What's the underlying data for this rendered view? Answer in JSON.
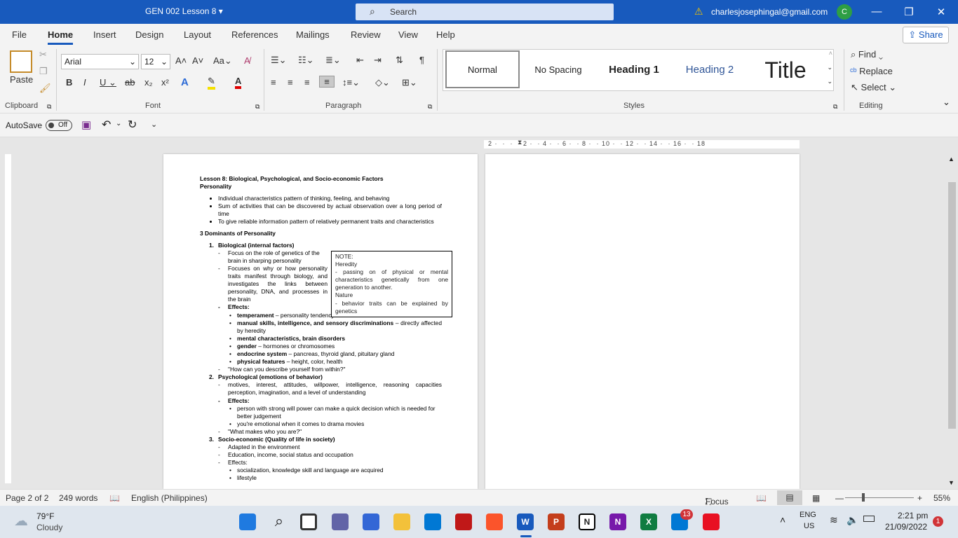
{
  "titlebar": {
    "doc_title": "GEN 002 Lesson 8",
    "search_placeholder": "Search",
    "account_email": "charlesjosephingal@gmail.com",
    "avatar_initial": "C"
  },
  "tabs": [
    "File",
    "Home",
    "Insert",
    "Design",
    "Layout",
    "References",
    "Mailings",
    "Review",
    "View",
    "Help"
  ],
  "share_label": "Share",
  "ribbon": {
    "paste_label": "Paste",
    "clipboard_label": "Clipboard",
    "font_label": "Font",
    "paragraph_label": "Paragraph",
    "styles_label": "Styles",
    "editing_label": "Editing",
    "font_name": "Arial",
    "font_size": "12",
    "styles": [
      "Normal",
      "No Spacing",
      "Heading 1",
      "Heading 2",
      "Title"
    ],
    "find_label": "Find",
    "replace_label": "Replace",
    "select_label": "Select"
  },
  "qat": {
    "autosave_label": "AutoSave",
    "autosave_state": "Off"
  },
  "document": {
    "title": "Lesson 8: Biological, Psychological, and Socio-economic Factors",
    "subtitle": "Personality",
    "intro_bullets": [
      "Individual characteristics pattern of thinking, feeling, and behaving",
      "Sum of activities that can be discovered by actual observation over a long period of time",
      "To give reliable information pattern of relatively permanent traits and characteristics"
    ],
    "section_heading": "3 Dominants of Personality",
    "bio_heading": "Biological (internal factors)",
    "bio_items": [
      "Focus on the role of genetics of the brain in sharping personality",
      "Focuses on why or how personality traits manifest through biology, and investigates the links between personality, DNA, and processes in the brain",
      "Effects:"
    ],
    "bio_effects": [
      {
        "b": "temperament",
        "t": " – personality tendency that we show at birth"
      },
      {
        "b": "manual skills, intelligence, and sensory discriminations",
        "t": " – directly affected by heredity"
      },
      {
        "b": "mental characteristics, brain disorders",
        "t": ""
      },
      {
        "b": "gender",
        "t": " – hormones or chromosomes"
      },
      {
        "b": "endocrine system",
        "t": " – pancreas, thyroid gland, pituitary gland"
      },
      {
        "b": "physical features",
        "t": " – height, color, health"
      }
    ],
    "bio_question": "\"How can you describe yourself from within?\"",
    "psy_heading": "Psychological (emotions of behavior)",
    "psy_items": [
      "motives, interest, attitudes, willpower, intelligence, reasoning capacities perception, imagination, and a level of understanding",
      "Effects:"
    ],
    "psy_effect1": "person with strong will power can make a quick decision which is needed for better judgement",
    "psy_effect2": "you're emotional when it comes to drama movies",
    "psy_question": "\"What makes who you are?\"",
    "soc_heading": "Socio-economic (Quality of life in society)",
    "soc_items": [
      "Adapted in the environment",
      "Education, income, social status and occupation",
      "Effects:"
    ],
    "soc_effect1": "socialization, knowledge skill and language are acquired",
    "soc_effect2": "lifestyle",
    "note": {
      "label": "NOTE:",
      "heredity_title": "Heredity",
      "heredity_text": "- passing on of physical or mental characteristics genetically from one generation to another.",
      "nature_title": "Nature",
      "nature_text": "- behavior traits can be explained by genetics"
    }
  },
  "status": {
    "page": "Page 2 of 2",
    "words": "249 words",
    "language": "English (Philippines)",
    "focus": "Focus",
    "zoom": "55%"
  },
  "taskbar": {
    "temp": "79°F",
    "weather": "Cloudy",
    "lang1": "ENG",
    "lang2": "US",
    "time": "2:21 pm",
    "date": "21/09/2022",
    "badge_mail": "13",
    "badge_notif": "1"
  },
  "colors": {
    "accent": "#185abd",
    "word_blue": "#185abd"
  }
}
